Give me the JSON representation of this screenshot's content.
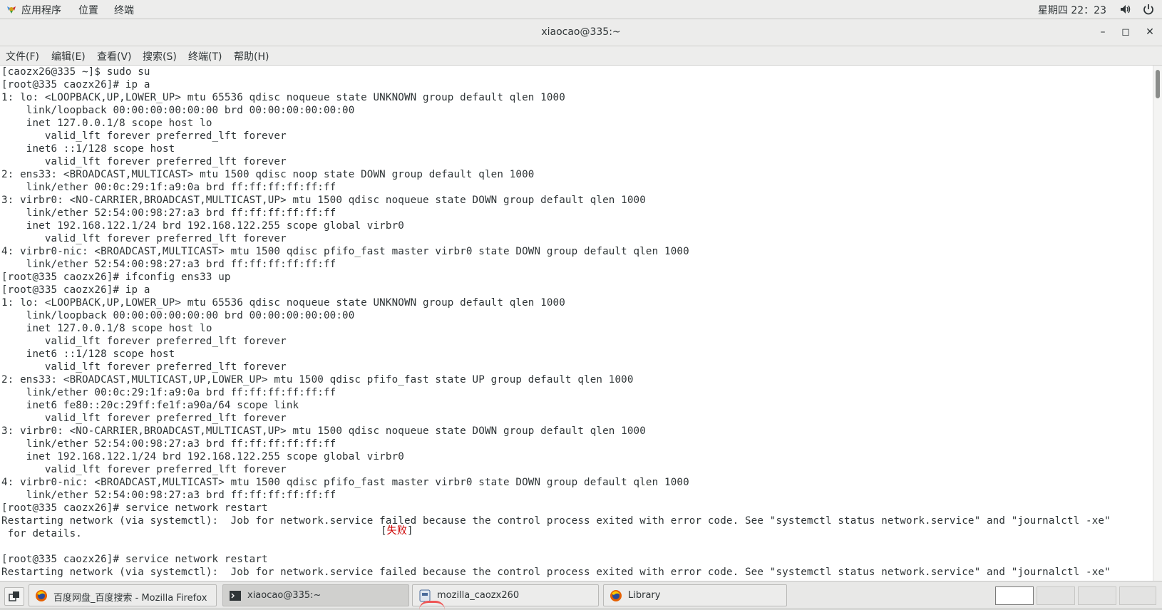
{
  "top_panel": {
    "menu": [
      "应用程序",
      "位置",
      "终端"
    ],
    "clock": "星期四 22：23"
  },
  "window": {
    "title": "xiaocao@335:~",
    "buttons": {
      "minimize": "–",
      "maximize": "◻",
      "close": "✕"
    },
    "menubar": [
      "文件(F)",
      "编辑(E)",
      "查看(V)",
      "搜索(S)",
      "终端(T)",
      "帮助(H)"
    ]
  },
  "terminal": {
    "lines": [
      "[caozx26@335 ~]$ sudo su",
      "[root@335 caozx26]# ip a",
      "1: lo: <LOOPBACK,UP,LOWER_UP> mtu 65536 qdisc noqueue state UNKNOWN group default qlen 1000",
      "    link/loopback 00:00:00:00:00:00 brd 00:00:00:00:00:00",
      "    inet 127.0.0.1/8 scope host lo",
      "       valid_lft forever preferred_lft forever",
      "    inet6 ::1/128 scope host",
      "       valid_lft forever preferred_lft forever",
      "2: ens33: <BROADCAST,MULTICAST> mtu 1500 qdisc noop state DOWN group default qlen 1000",
      "    link/ether 00:0c:29:1f:a9:0a brd ff:ff:ff:ff:ff:ff",
      "3: virbr0: <NO-CARRIER,BROADCAST,MULTICAST,UP> mtu 1500 qdisc noqueue state DOWN group default qlen 1000",
      "    link/ether 52:54:00:98:27:a3 brd ff:ff:ff:ff:ff:ff",
      "    inet 192.168.122.1/24 brd 192.168.122.255 scope global virbr0",
      "       valid_lft forever preferred_lft forever",
      "4: virbr0-nic: <BROADCAST,MULTICAST> mtu 1500 qdisc pfifo_fast master virbr0 state DOWN group default qlen 1000",
      "    link/ether 52:54:00:98:27:a3 brd ff:ff:ff:ff:ff:ff",
      "[root@335 caozx26]# ifconfig ens33 up",
      "[root@335 caozx26]# ip a",
      "1: lo: <LOOPBACK,UP,LOWER_UP> mtu 65536 qdisc noqueue state UNKNOWN group default qlen 1000",
      "    link/loopback 00:00:00:00:00:00 brd 00:00:00:00:00:00",
      "    inet 127.0.0.1/8 scope host lo",
      "       valid_lft forever preferred_lft forever",
      "    inet6 ::1/128 scope host",
      "       valid_lft forever preferred_lft forever",
      "2: ens33: <BROADCAST,MULTICAST,UP,LOWER_UP> mtu 1500 qdisc pfifo_fast state UP group default qlen 1000",
      "    link/ether 00:0c:29:1f:a9:0a brd ff:ff:ff:ff:ff:ff",
      "    inet6 fe80::20c:29ff:fe1f:a90a/64 scope link",
      "       valid_lft forever preferred_lft forever",
      "3: virbr0: <NO-CARRIER,BROADCAST,MULTICAST,UP> mtu 1500 qdisc noqueue state DOWN group default qlen 1000",
      "    link/ether 52:54:00:98:27:a3 brd ff:ff:ff:ff:ff:ff",
      "    inet 192.168.122.1/24 brd 192.168.122.255 scope global virbr0",
      "       valid_lft forever preferred_lft forever",
      "4: virbr0-nic: <BROADCAST,MULTICAST> mtu 1500 qdisc pfifo_fast master virbr0 state DOWN group default qlen 1000",
      "    link/ether 52:54:00:98:27:a3 brd ff:ff:ff:ff:ff:ff",
      "[root@335 caozx26]# service network restart",
      "Restarting network (via systemctl):  Job for network.service failed because the control process exited with error code. See \"systemctl status network.service\" and \"journalctl -xe\"",
      " for details.",
      "",
      "[root@335 caozx26]# service network restart",
      "Restarting network (via systemctl):  Job for network.service failed because the control process exited with error code. See \"systemctl status network.service\" and \"journalctl -xe\""
    ],
    "fail_text": "失败",
    "fail_open": "[",
    "fail_close": "]"
  },
  "taskbar": {
    "tasks": [
      {
        "label": "百度网盘_百度搜索 - Mozilla Firefox",
        "icon": "firefox-icon"
      },
      {
        "label": "xiaocao@335:~",
        "icon": "terminal-icon"
      },
      {
        "label": "mozilla_caozx260",
        "icon": "file-manager-icon"
      },
      {
        "label": "Library",
        "icon": "firefox-icon"
      }
    ]
  },
  "colors": {
    "fail": "#cc0000",
    "terminal_text": "#2e3436"
  }
}
